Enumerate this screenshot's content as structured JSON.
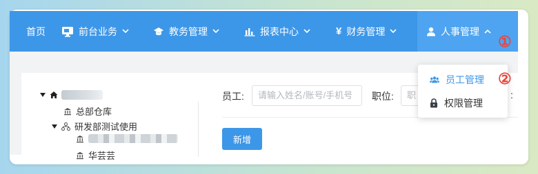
{
  "nav": {
    "items": [
      {
        "label": "首页",
        "icon": "",
        "chevron": ""
      },
      {
        "label": "前台业务",
        "icon": "monitor-icon",
        "chevron": "down"
      },
      {
        "label": "教务管理",
        "icon": "graduation-cap-icon",
        "chevron": "down"
      },
      {
        "label": "报表中心",
        "icon": "bar-chart-icon",
        "chevron": "down"
      },
      {
        "label": "财务管理",
        "icon": "yen-icon",
        "chevron": "down"
      },
      {
        "label": "人事管理",
        "icon": "user-icon",
        "chevron": "up"
      }
    ],
    "active_index": 5,
    "marker": "①"
  },
  "dropdown": {
    "items": [
      {
        "label": "员工管理",
        "icon": "users-icon"
      },
      {
        "label": "权限管理",
        "icon": "lock-icon"
      }
    ],
    "marker": "②"
  },
  "tree": {
    "nodes": [
      {
        "label": "总部仓库",
        "icon": "bank-icon"
      },
      {
        "label": "研发部测试使用",
        "icon": "org-chart-icon"
      },
      {
        "label": "华芸芸",
        "icon": "bank-icon"
      }
    ]
  },
  "filter": {
    "employee_label": "员工:",
    "employee_placeholder": "请输入姓名/账号/手机号",
    "position_label": "职位:",
    "position_placeholder": "职",
    "trailing_colon": ":"
  },
  "actions": {
    "add_label": "新增"
  },
  "colors": {
    "primary": "#3d97e8",
    "marker": "#e8463c",
    "dropdown_active": "#3d97e8",
    "text": "#333333"
  }
}
